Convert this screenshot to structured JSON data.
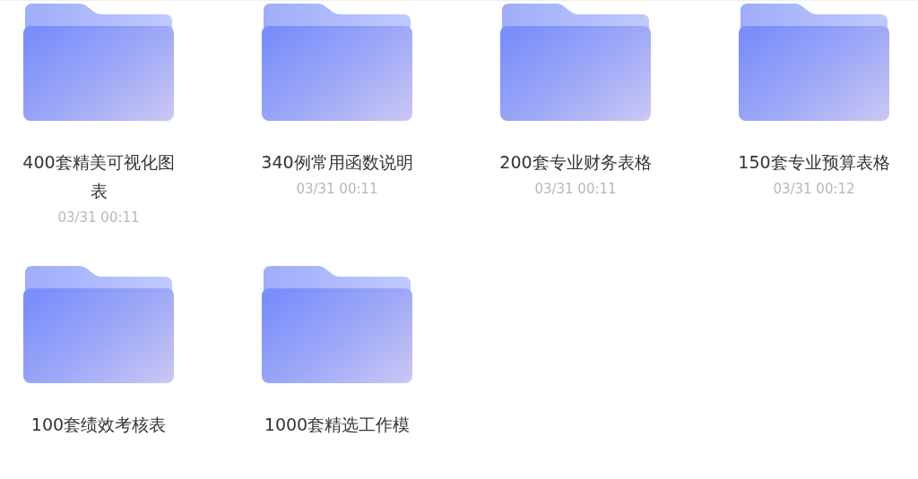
{
  "folders": [
    {
      "name": "400套精美可视化图表",
      "date": "03/31 00:11"
    },
    {
      "name": "340例常用函数说明",
      "date": "03/31 00:11"
    },
    {
      "name": "200套专业财务表格",
      "date": "03/31 00:11"
    },
    {
      "name": "150套专业预算表格",
      "date": "03/31 00:12"
    },
    {
      "name": "100套绩效考核表"
    },
    {
      "name": "1000套精选工作模"
    }
  ]
}
